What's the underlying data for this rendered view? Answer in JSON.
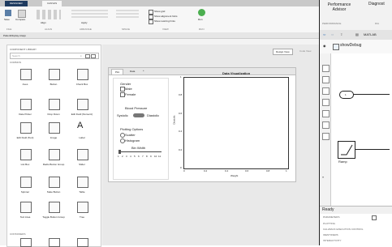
{
  "appdesigner": {
    "top_tabs": [
      "DESIGNER",
      "CANVAS"
    ],
    "ribbon": {
      "buttons": [
        "Save",
        "Compare",
        "Align",
        "Apply",
        "Run"
      ],
      "checkboxes": [
        "Show grid",
        "Show alignment hints",
        "Show resizing hints"
      ],
      "group_labels": [
        "FILE",
        "ALIGN",
        "ARRANGE",
        "SPACE",
        "VIEW",
        "RUN"
      ]
    },
    "file_tab": "PatientDisplay.mlapp",
    "component_library": {
      "title": "COMPONENT LIBRARY",
      "search_placeholder": "Search",
      "section_common": "COMMON",
      "section_containers": "CONTAINERS",
      "items": [
        {
          "label": "Axes",
          "icon": "axes-icon"
        },
        {
          "label": "Button",
          "icon": "button-icon"
        },
        {
          "label": "Check Box",
          "icon": "checkbox-icon"
        },
        {
          "label": "Date Picker",
          "icon": "date-picker-icon"
        },
        {
          "label": "Drop Down",
          "icon": "dropdown-icon"
        },
        {
          "label": "Edit Field (Numeric)",
          "icon": "numeric-field-icon"
        },
        {
          "label": "Edit Field (Text)",
          "icon": "text-field-icon"
        },
        {
          "label": "Image",
          "icon": "image-icon"
        },
        {
          "label": "Label",
          "icon": "label-icon"
        },
        {
          "label": "List Box",
          "icon": "listbox-icon"
        },
        {
          "label": "Radio Button Group",
          "icon": "radio-group-icon"
        },
        {
          "label": "Slider",
          "icon": "slider-icon"
        },
        {
          "label": "Spinner",
          "icon": "spinner-icon"
        },
        {
          "label": "State Button",
          "icon": "state-button-icon"
        },
        {
          "label": "Table",
          "icon": "table-icon"
        },
        {
          "label": "Text Area",
          "icon": "text-area-icon"
        },
        {
          "label": "Toggle Button Group",
          "icon": "toggle-group-icon"
        },
        {
          "label": "Tree",
          "icon": "tree-icon"
        }
      ]
    },
    "view_toggle": [
      "Design View",
      "Code View"
    ],
    "app_tabs": [
      "Plot",
      "Data"
    ],
    "controls": {
      "gender_title": "Gender",
      "male": "Male",
      "female": "Female",
      "bp_title": "Blood Pressure",
      "systolic": "Systolic",
      "diastolic": "Diastolic",
      "plotting_title": "Plotting Options",
      "scatter": "Scatter",
      "histogram": "Histogram",
      "bin_width": "Bin Width",
      "slider_ticks": [
        "1",
        "2",
        "3",
        "4",
        "5",
        "6",
        "7",
        "8",
        "9",
        "10",
        "11"
      ]
    },
    "chart": {
      "title": "Data Visualization",
      "xlabel": "Weight",
      "ylabel": "Diastolic",
      "xticks": [
        "0",
        "0.2",
        "0.4",
        "0.6",
        "0.8",
        "1"
      ],
      "yticks": [
        "0",
        "0.2",
        "0.4",
        "0.6",
        "0.8",
        "1"
      ]
    }
  },
  "simulink": {
    "menu_items": [
      "Performance Advisor",
      "Diagnost"
    ],
    "section_label": "PERFORMANCE",
    "section_label2": "DIA",
    "nav_path": "MATLAB",
    "breadcrumb": "showDebug",
    "blocks": [
      {
        "label": "1",
        "kind": "inport"
      },
      {
        "label": "Ramp",
        "kind": "ramp"
      }
    ],
    "status": "Ready",
    "prop_groups": [
      "PARAMETERS",
      "PLOTTING",
      "CALLBACK EXECUTION CONTROL",
      "IDENTIFIERS",
      "INTERACTIVITY"
    ]
  }
}
